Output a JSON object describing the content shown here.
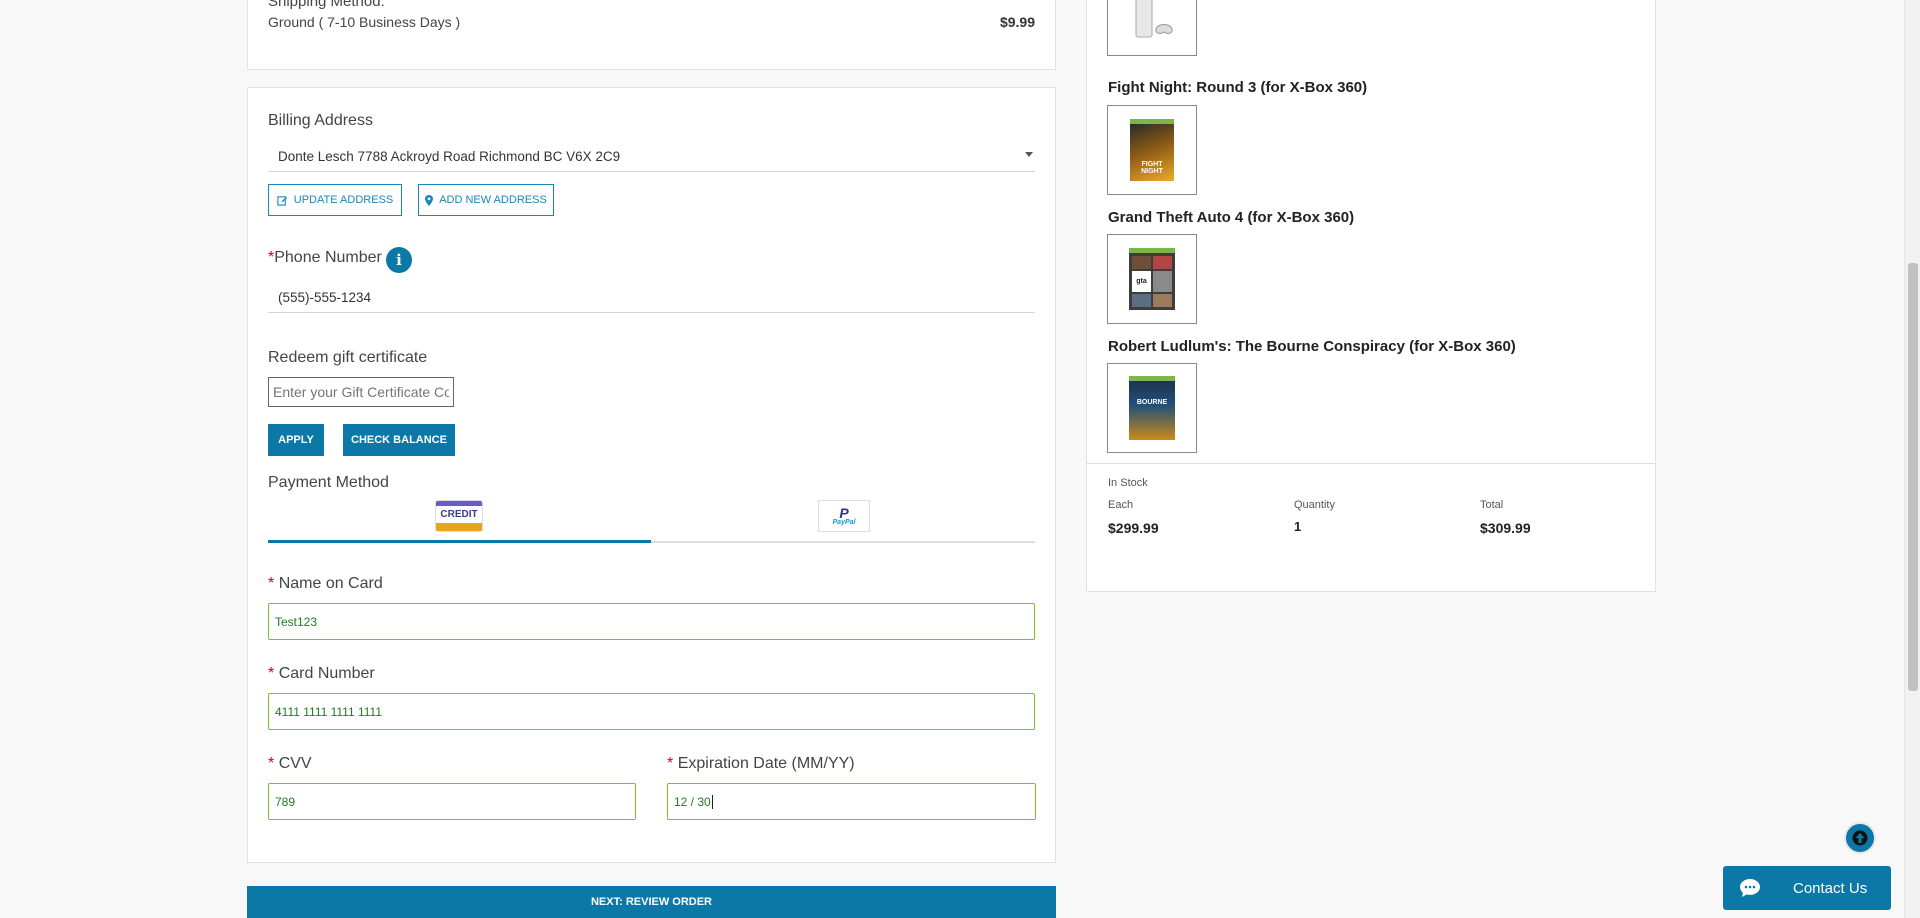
{
  "shipping": {
    "label": "Shipping Method:",
    "method": "Ground ( 7-10 Business Days )",
    "price": "$9.99"
  },
  "billing": {
    "label": "Billing Address",
    "selected": "Donte Lesch 7788 Ackroyd Road Richmond BC V6X 2C9",
    "update_btn": "UPDATE ADDRESS",
    "add_btn": "ADD NEW ADDRESS"
  },
  "phone": {
    "required_mark": "*",
    "label": "Phone Number",
    "value": "(555)-555-1234"
  },
  "gift": {
    "label": "Redeem gift certificate",
    "placeholder": "Enter your Gift Certificate Code",
    "apply_btn": "APPLY",
    "balance_btn": "CHECK BALANCE"
  },
  "payment": {
    "label": "Payment Method",
    "credit_tab": "CREDIT",
    "paypal_tab": "PayPal",
    "name_label": "Name on Card",
    "name_value": "Test123",
    "card_label": "Card Number",
    "card_value": "4111 1111 1111 1111",
    "cvv_label": "CVV",
    "cvv_value": "789",
    "exp_label": "Expiration Date (MM/YY)",
    "exp_value": "12 / 30",
    "req": "*"
  },
  "next_btn": "NEXT: REVIEW ORDER",
  "products": [
    {
      "title": "Fight Night: Round 3 (for X-Box 360)"
    },
    {
      "title": "Grand Theft Auto 4 (for X-Box 360)"
    },
    {
      "title": "Robert Ludlum's: The Bourne Conspiracy (for X-Box 360)"
    }
  ],
  "summary": {
    "stock": "In Stock",
    "each_label": "Each",
    "each_value": "$299.99",
    "qty_label": "Quantity",
    "qty_value": "1",
    "total_label": "Total",
    "total_value": "$309.99"
  },
  "contact": {
    "label": "Contact Us"
  },
  "colors": {
    "accent": "#0b78a8",
    "valid": "#7cc22a",
    "required": "#d0021b"
  }
}
